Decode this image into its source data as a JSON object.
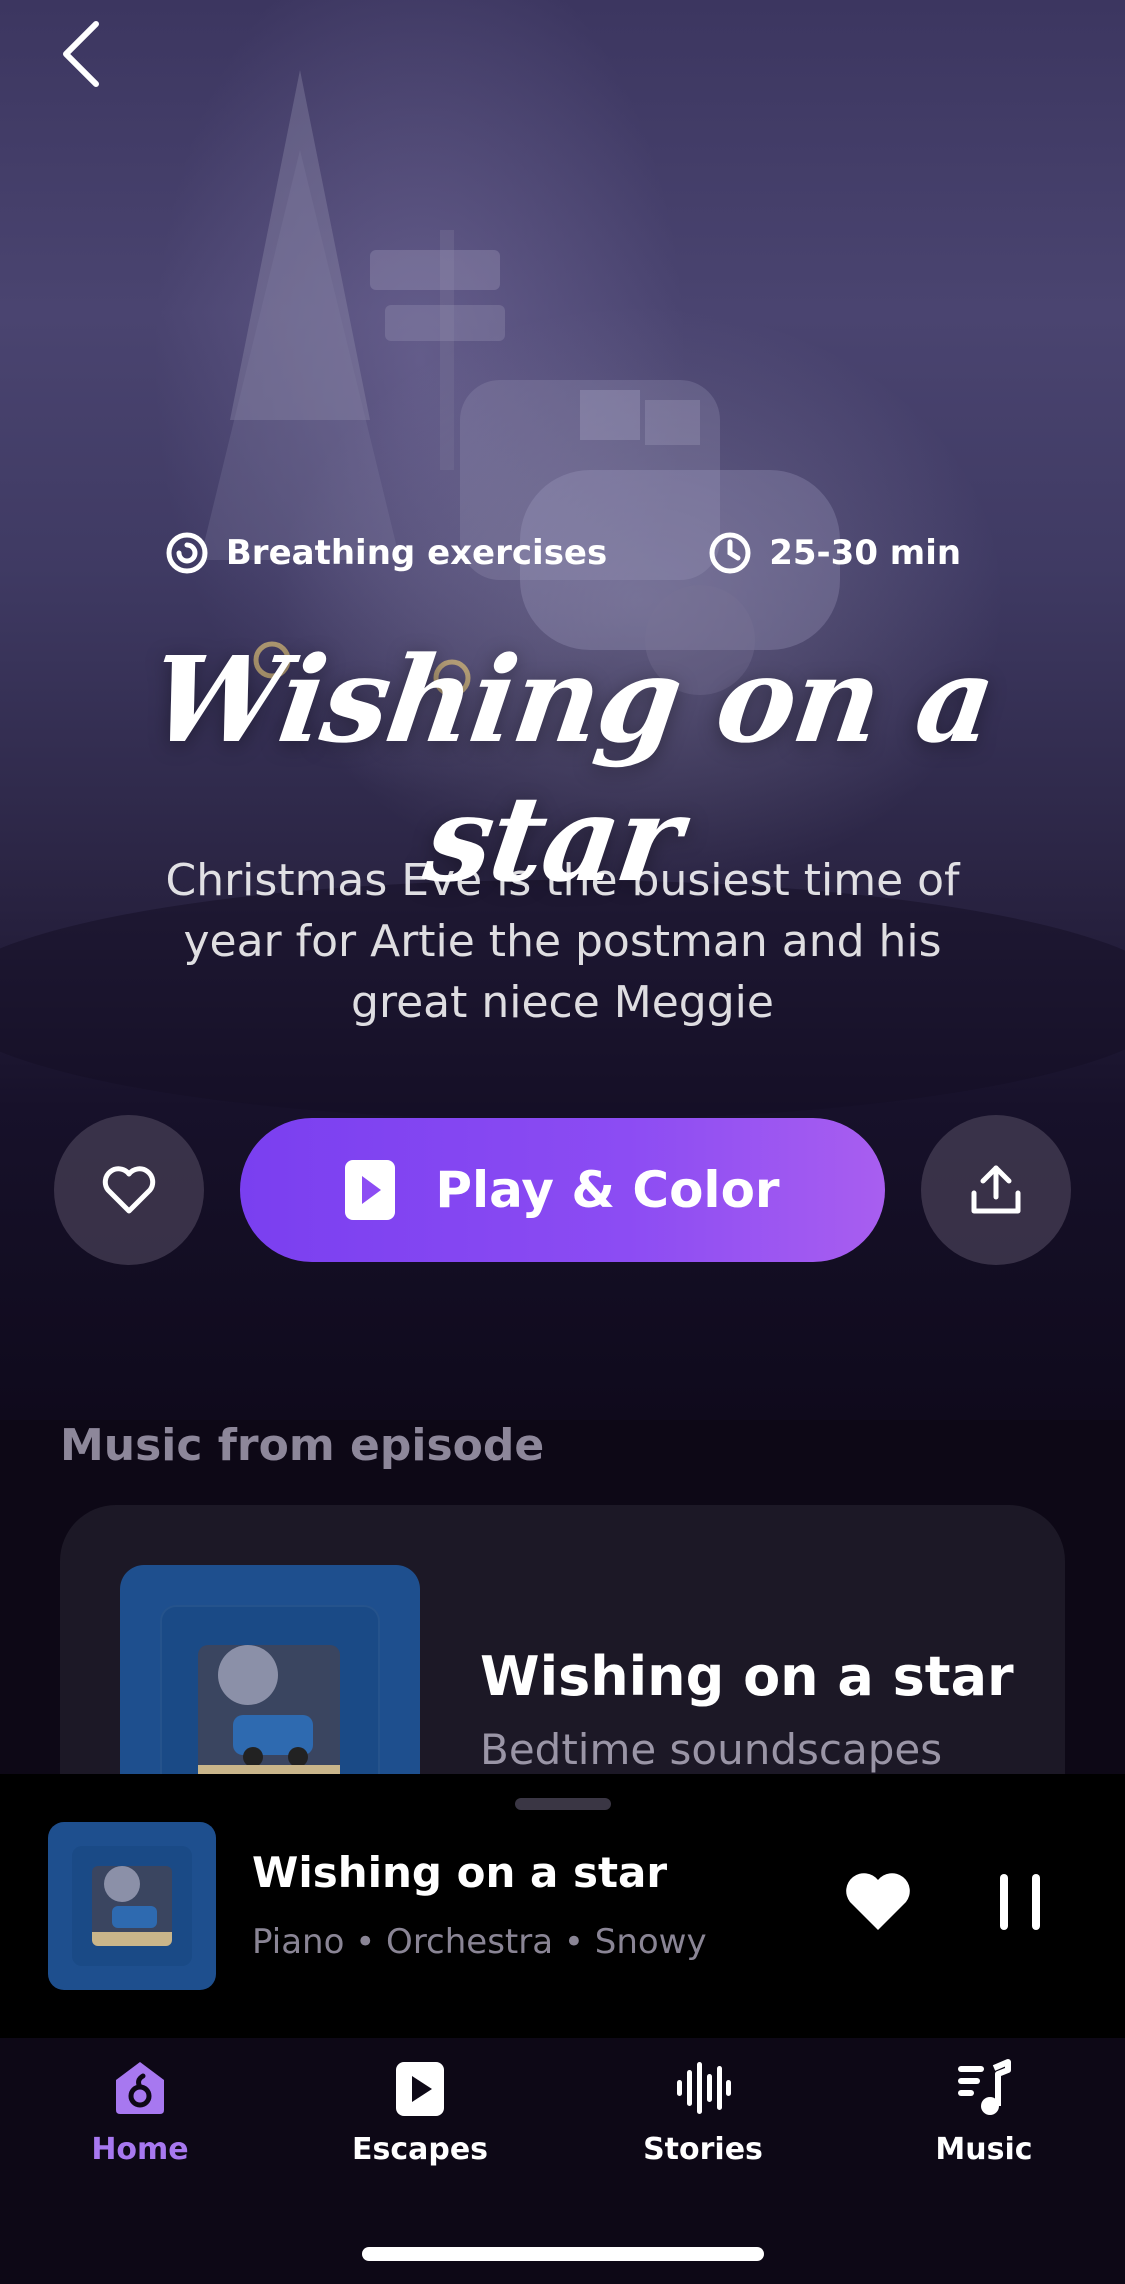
{
  "episode": {
    "category": "Breathing exercises",
    "duration": "25-30 min",
    "title": "Wishing on a star",
    "description": "Christmas Eve is the busiest time of year for Artie the postman and his great niece Meggie"
  },
  "actions": {
    "play_label": "Play & Color"
  },
  "music_section": {
    "heading": "Music from episode",
    "card": {
      "title": "Wishing on a star",
      "subtitle": "Bedtime soundscapes"
    }
  },
  "now_playing": {
    "title": "Wishing on a star",
    "subtitle": "Piano • Orchestra • Snowy"
  },
  "tabs": [
    {
      "label": "Home",
      "icon": "home-icon",
      "active": true
    },
    {
      "label": "Escapes",
      "icon": "play-square-icon",
      "active": false
    },
    {
      "label": "Stories",
      "icon": "waveform-icon",
      "active": false
    },
    {
      "label": "Music",
      "icon": "music-note-icon",
      "active": false
    }
  ],
  "colors": {
    "accent": "#8c4cf3",
    "active_tab": "#a778f0",
    "background": "#0d0816"
  }
}
